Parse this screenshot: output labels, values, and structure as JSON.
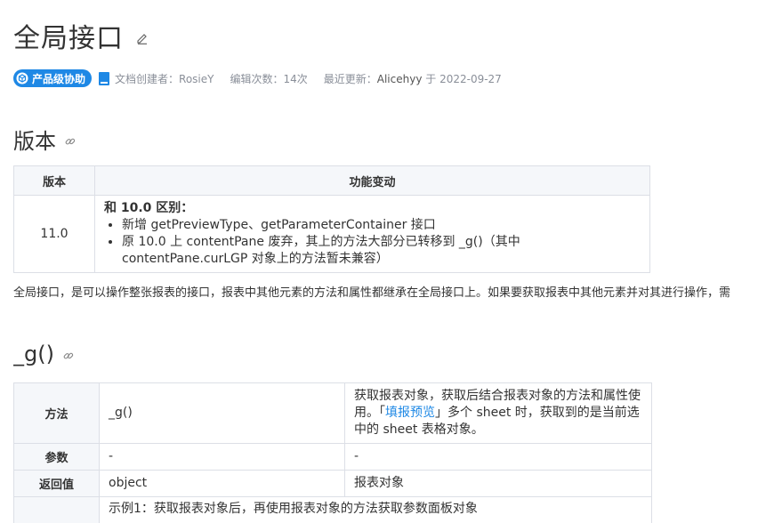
{
  "header": {
    "title": "全局接口",
    "badge": "产品级协助",
    "creator": "文档创建者：RosieY",
    "edits": "编辑次数：14次",
    "updated_prefix": "最近更新：",
    "updated_user": "Alicehyy",
    "updated_mid": " 于 ",
    "updated_date": "2022-09-27"
  },
  "sections": {
    "version": "版本",
    "g": "_g()"
  },
  "version_table": {
    "headers": [
      "版本",
      "功能变动"
    ],
    "version": "11.0",
    "diff_title": "和 10.0 区别：",
    "items": [
      "新增 getPreviewType、getParameterContainer 接口",
      "原 10.0 上  contentPane 废弃，其上的方法大部分已转移到 _g()（其中 contentPane.curLGP 对象上的方法暂未兼容）"
    ]
  },
  "intro": "全局接口，是可以操作整张报表的接口，报表中其他元素的方法和属性都继承在全局接口上。如果要获取报表中其他元素并对其进行操作，需",
  "g_table": {
    "method_label": "方法",
    "method": "_g()",
    "desc_pre": "获取报表对象，获取后结合报表对象的方法和属性使用。「",
    "desc_link": "填报预览",
    "desc_post": "」多个 sheet 时，获取到的是当前选中的 sheet 表格对象。",
    "param_label": "参数",
    "param_val": "-",
    "param_desc": "-",
    "return_label": "返回值",
    "return_val": "object",
    "return_desc": "报表对象",
    "example": "示例1：获取报表对象后，再使用报表对象的方法获取参数面板对象"
  }
}
